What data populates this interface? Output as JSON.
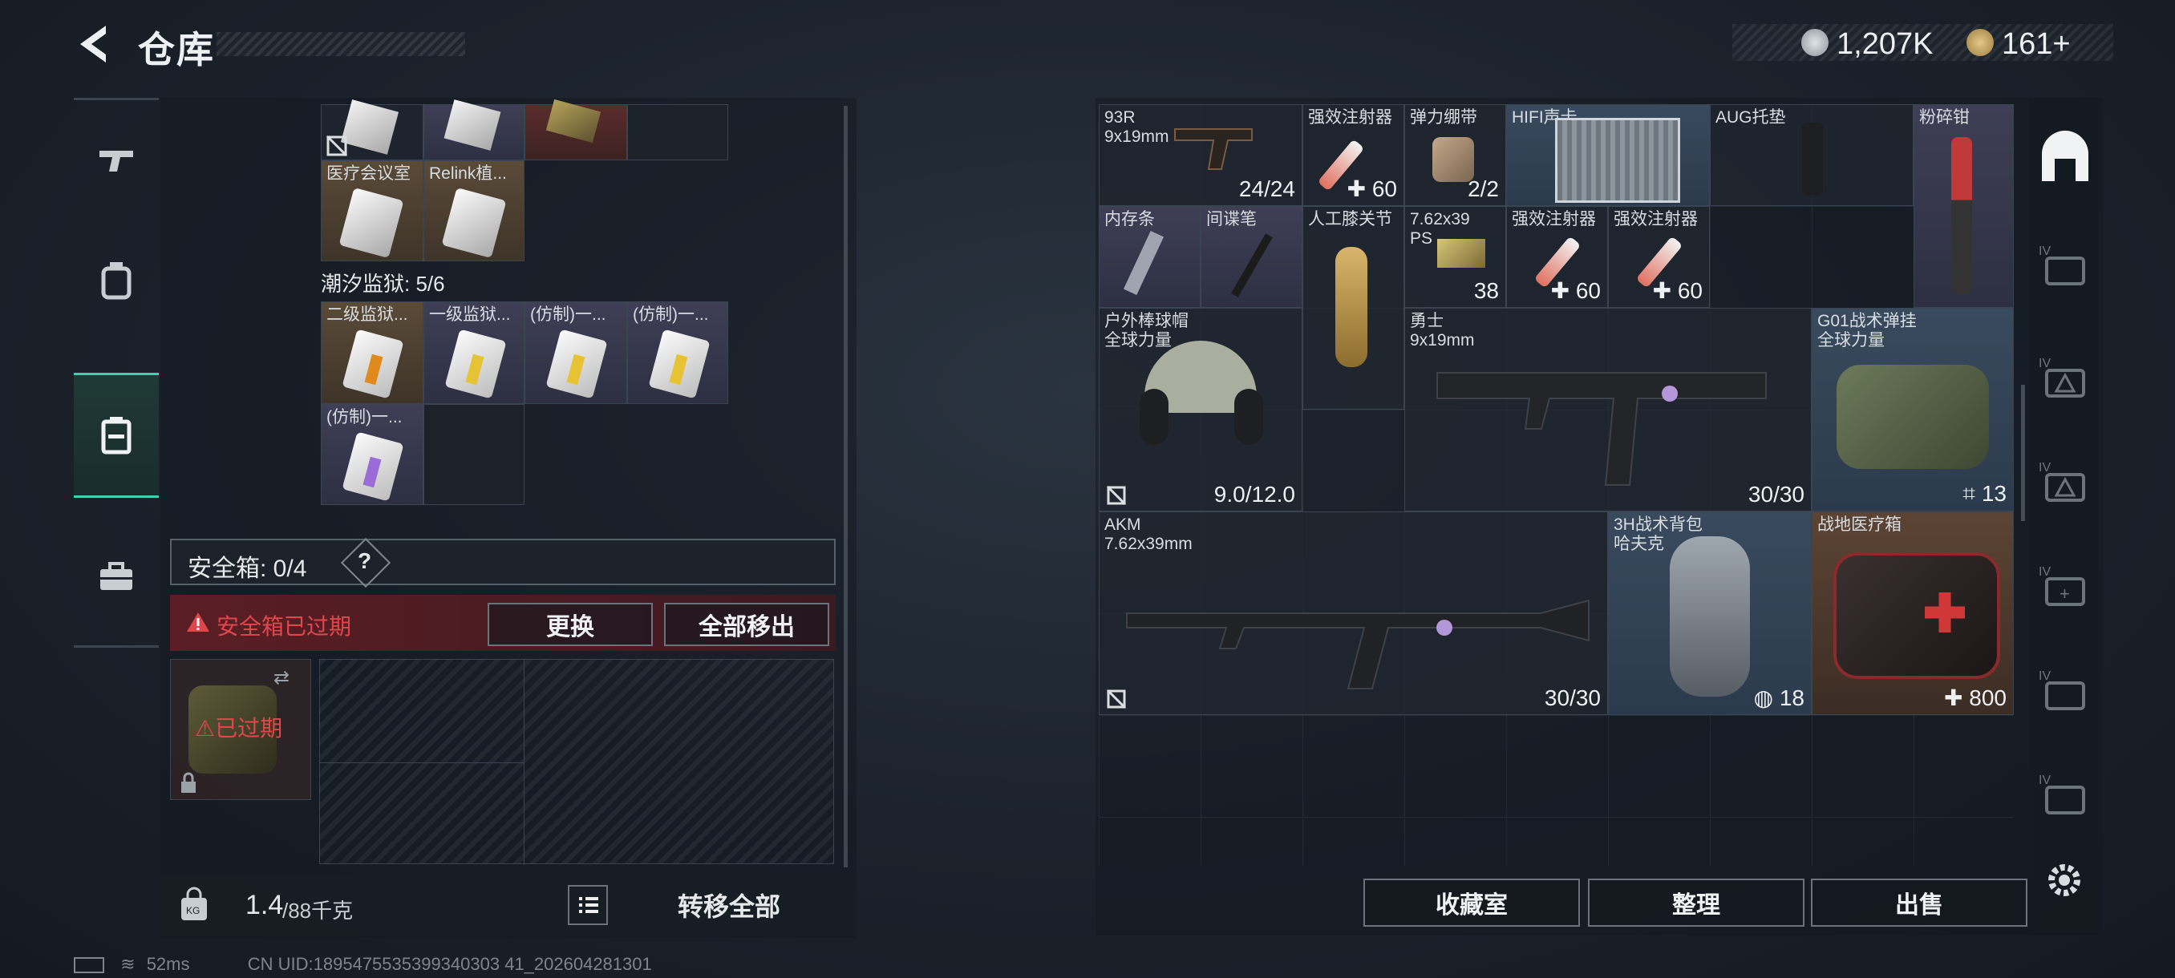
{
  "header": {
    "title": "仓库"
  },
  "currency": {
    "coins": "1,207K",
    "tokens": "161+"
  },
  "left_nav": [
    "gun-icon",
    "backpack-icon",
    "container-icon",
    "toolbox-icon"
  ],
  "stash": {
    "top_items": [
      {
        "name": "医疗会议室"
      },
      {
        "name": "Relink植..."
      }
    ],
    "prison_label": "潮汐监狱: 5/6",
    "prison_items": [
      {
        "name": "二级监狱..."
      },
      {
        "name": "一级监狱..."
      },
      {
        "name": "(仿制)一..."
      },
      {
        "name": "(仿制)一..."
      },
      {
        "name": "(仿制)一..."
      }
    ]
  },
  "safe": {
    "label": "安全箱: 0/4",
    "help": "?",
    "warning": "安全箱已过期",
    "replace_btn": "更换",
    "move_all_btn": "全部移出",
    "expired_tag": "已过期"
  },
  "weight": {
    "value": "1.4",
    "max": "/88千克",
    "transfer_all": "转移全部"
  },
  "inventory": [
    {
      "name": "93R",
      "sub": "9x19mm",
      "val": "24/24"
    },
    {
      "name": "强效注射器",
      "val": "60"
    },
    {
      "name": "弹力绷带",
      "val": "2/2"
    },
    {
      "name": "HIFI声卡",
      "val": ""
    },
    {
      "name": "AUG托垫",
      "val": ""
    },
    {
      "name": "粉碎钳",
      "val": ""
    },
    {
      "name": "内存条",
      "val": ""
    },
    {
      "name": "间谍笔",
      "val": ""
    },
    {
      "name": "人工膝关节",
      "val": ""
    },
    {
      "name": "7.62x39",
      "sub": "PS",
      "val": "38"
    },
    {
      "name": "强效注射器",
      "val": "60"
    },
    {
      "name": "强效注射器",
      "val": "60"
    },
    {
      "name": "户外棒球帽",
      "sub": "全球力量",
      "val": "9.0/12.0"
    },
    {
      "name": "勇士",
      "sub": "9x19mm",
      "val": "30/30"
    },
    {
      "name": "G01战术弹挂",
      "sub": "全球力量",
      "val": "13"
    },
    {
      "name": "AKM",
      "sub": "7.62x39mm",
      "val": "30/30"
    },
    {
      "name": "3H战术背包",
      "sub": "哈夫克",
      "val": "18"
    },
    {
      "name": "战地医疗箱",
      "val": "800"
    }
  ],
  "bottom_buttons": {
    "collection": "收藏室",
    "sort": "整理",
    "sell": "出售"
  },
  "status": {
    "ping": "52ms",
    "uid": "CN UID:1895475535399340303 41_202604281301"
  },
  "colors": {
    "accent": "#3bd2b0",
    "warning": "#e0474c",
    "gold": "#d8b56a",
    "heal": "#ffffff"
  }
}
